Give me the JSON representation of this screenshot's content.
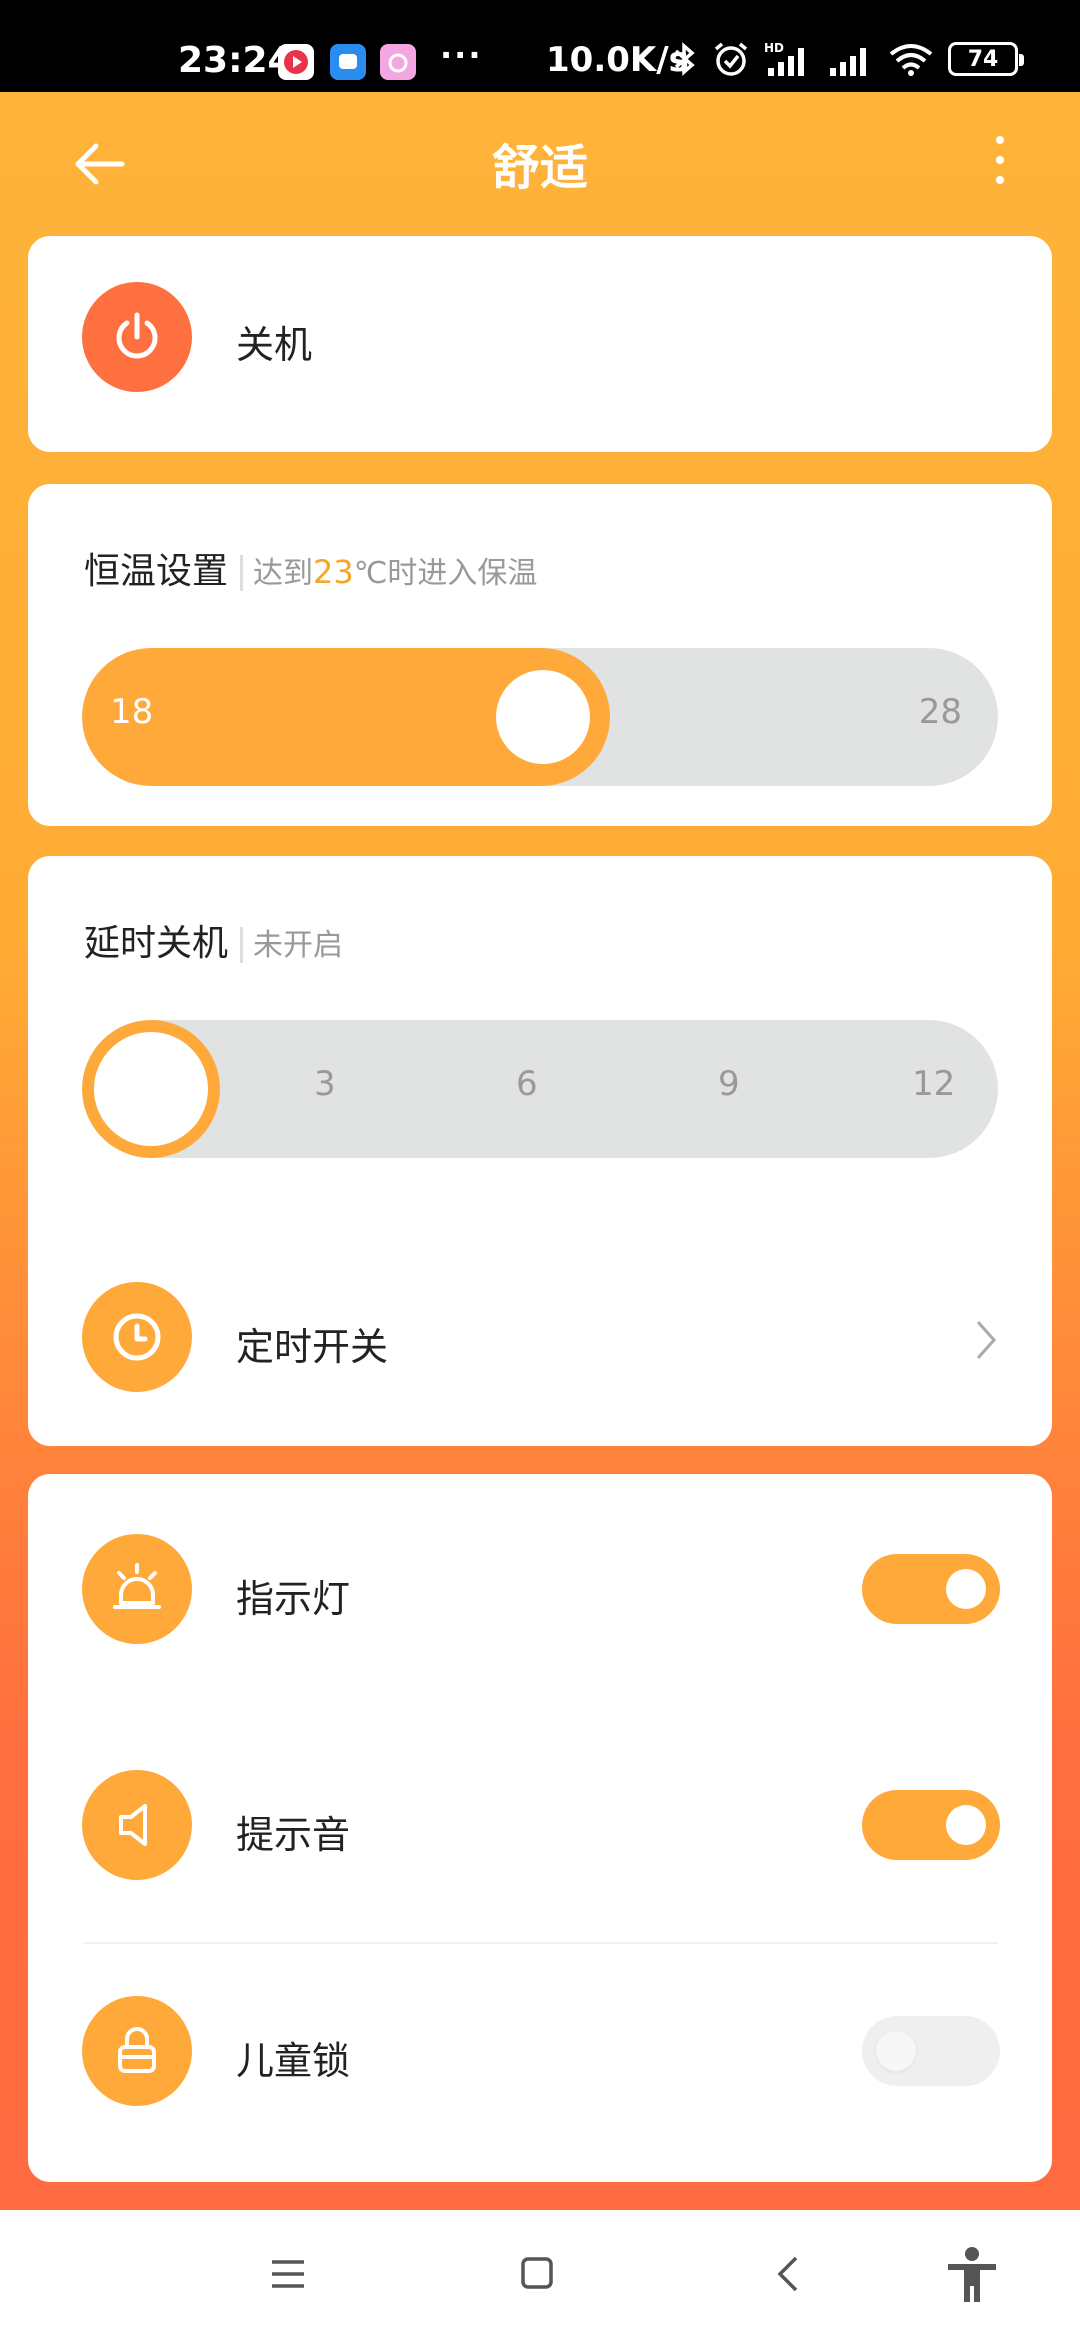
{
  "status_bar": {
    "time": "23:24",
    "dots": "···",
    "net_speed": "10.0K/s",
    "battery": "74",
    "icons": [
      "video-app-icon",
      "message-app-icon",
      "camera-app-icon",
      "bluetooth-icon",
      "alarm-icon",
      "hd-signal-icon",
      "signal-icon",
      "wifi-icon"
    ]
  },
  "header": {
    "title": "舒适"
  },
  "power": {
    "label": "关机"
  },
  "thermostat": {
    "title": "恒温设置",
    "hint_prefix": "达到",
    "hint_value": "23",
    "hint_suffix": "℃时进入保温",
    "min_label": "18",
    "max_label": "28",
    "value": 23
  },
  "delay_off": {
    "title": "延时关机",
    "status": "未开启",
    "ticks": [
      "3",
      "6",
      "9",
      "12"
    ],
    "value": 0
  },
  "timer": {
    "label": "定时开关"
  },
  "settings": [
    {
      "label": "指示灯",
      "on": true,
      "icon": "alarm-light-icon"
    },
    {
      "label": "提示音",
      "on": true,
      "icon": "speaker-icon"
    },
    {
      "label": "儿童锁",
      "on": false,
      "icon": "lock-icon"
    }
  ],
  "colors": {
    "accent": "#ffa93a",
    "power": "#ff7040",
    "track": "#e1e3e3"
  }
}
